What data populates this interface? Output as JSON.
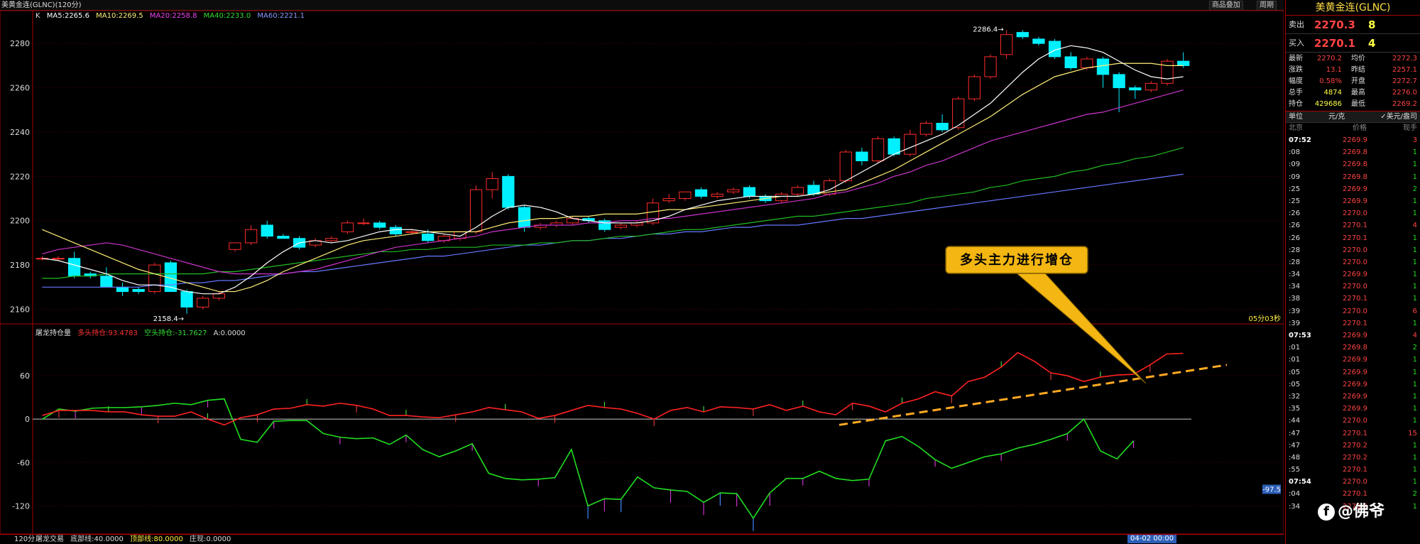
{
  "header": {
    "title": "美黄金连(GLNC)(120分)",
    "buttons": [
      "商品叠加",
      "周期"
    ]
  },
  "ma_legend": {
    "k": "K",
    "ma5": "MA5:2265.6",
    "ma10": "MA10:2269.5",
    "ma20": "MA20:2258.8",
    "ma40": "MA40:2233.0",
    "ma60": "MA60:2221.1"
  },
  "sub_legend": {
    "name": "屠龙持仓量",
    "long": "多头持仓:93.4783",
    "short": "空头持仓:-31.7627",
    "a": "A:0.0000"
  },
  "bottom": {
    "period": "120分",
    "indicator": "屠龙交易",
    "bottom_line": "底部线:40.0000",
    "top_line": "顶部线:80.0000",
    "zhuang": "庄现:0.0000",
    "time_badge": "04-02 00:00"
  },
  "countdown": "05分03秒",
  "callout": "多头主力进行增仓",
  "colors": {
    "up": "#ff2b2b",
    "down": "#00f0ff",
    "ma5": "#ffffff",
    "ma10": "#ffee77",
    "ma20": "#cc33cc",
    "ma40": "#22bb22",
    "ma60": "#6677ff",
    "long": "#ff2222",
    "short": "#22dd22",
    "trend": "#ffaa22",
    "callout_bg": "#f3b612"
  },
  "chart_data": [
    {
      "type": "candlestick",
      "yticks": [
        2160,
        2180,
        2200,
        2220,
        2240,
        2260,
        2280
      ],
      "ylim": [
        2156,
        2290
      ],
      "high_label": "2286.4",
      "low_label": "2158.4",
      "candles": [
        [
          2183,
          2184,
          2182,
          2183
        ],
        [
          2183,
          2184,
          2182,
          2183
        ],
        [
          2183,
          2186,
          2174,
          2175
        ],
        [
          2176,
          2177,
          2174,
          2175
        ],
        [
          2175,
          2179,
          2171,
          2170
        ],
        [
          2170,
          2172,
          2166,
          2168
        ],
        [
          2169,
          2170,
          2167,
          2168
        ],
        [
          2168,
          2181,
          2167,
          2180
        ],
        [
          2181,
          2182,
          2168,
          2168
        ],
        [
          2168,
          2169,
          2158,
          2161
        ],
        [
          2161,
          2166,
          2160,
          2165
        ],
        [
          2165,
          2168,
          2164,
          2167
        ],
        [
          2187,
          2190,
          2186,
          2190
        ],
        [
          2190,
          2198,
          2189,
          2196
        ],
        [
          2198,
          2200,
          2192,
          2193
        ],
        [
          2193,
          2194,
          2192,
          2192
        ],
        [
          2192,
          2193,
          2187,
          2188
        ],
        [
          2189,
          2192,
          2188,
          2191
        ],
        [
          2191,
          2193,
          2190,
          2192
        ],
        [
          2195,
          2200,
          2194,
          2199
        ],
        [
          2199,
          2201,
          2198,
          2199
        ],
        [
          2199,
          2200,
          2196,
          2197
        ],
        [
          2197,
          2198,
          2193,
          2194
        ],
        [
          2195,
          2196,
          2194,
          2195
        ],
        [
          2194,
          2196,
          2190,
          2191
        ],
        [
          2191,
          2194,
          2190,
          2193
        ],
        [
          2192,
          2195,
          2191,
          2195
        ],
        [
          2195,
          2216,
          2194,
          2214
        ],
        [
          2214,
          2222,
          2210,
          2219
        ],
        [
          2220,
          2221,
          2205,
          2206
        ],
        [
          2206,
          2207,
          2195,
          2197
        ],
        [
          2197,
          2199,
          2196,
          2198
        ],
        [
          2198,
          2200,
          2197,
          2199
        ],
        [
          2199,
          2202,
          2198,
          2201
        ],
        [
          2201,
          2202,
          2199,
          2200
        ],
        [
          2200,
          2201,
          2195,
          2196
        ],
        [
          2197,
          2199,
          2196,
          2198
        ],
        [
          2198,
          2200,
          2197,
          2199
        ],
        [
          2199,
          2210,
          2198,
          2208
        ],
        [
          2209,
          2212,
          2208,
          2210
        ],
        [
          2210,
          2213,
          2209,
          2213
        ],
        [
          2214,
          2215,
          2210,
          2211
        ],
        [
          2211,
          2213,
          2210,
          2212
        ],
        [
          2213,
          2215,
          2212,
          2214
        ],
        [
          2215,
          2216,
          2210,
          2211
        ],
        [
          2211,
          2212,
          2208,
          2209
        ],
        [
          2209,
          2213,
          2208,
          2212
        ],
        [
          2212,
          2216,
          2211,
          2215
        ],
        [
          2216,
          2218,
          2211,
          2212
        ],
        [
          2212,
          2219,
          2211,
          2218
        ],
        [
          2218,
          2232,
          2217,
          2231
        ],
        [
          2231,
          2233,
          2225,
          2227
        ],
        [
          2227,
          2238,
          2226,
          2237
        ],
        [
          2237,
          2238,
          2229,
          2230
        ],
        [
          2230,
          2241,
          2229,
          2239
        ],
        [
          2239,
          2245,
          2238,
          2244
        ],
        [
          2244,
          2248,
          2240,
          2241
        ],
        [
          2242,
          2256,
          2241,
          2255
        ],
        [
          2255,
          2266,
          2254,
          2265
        ],
        [
          2265,
          2275,
          2264,
          2274
        ],
        [
          2275,
          2286,
          2273,
          2284
        ],
        [
          2285,
          2286,
          2282,
          2283
        ],
        [
          2282,
          2283,
          2279,
          2280
        ],
        [
          2281,
          2282,
          2273,
          2274
        ],
        [
          2274,
          2276,
          2268,
          2269
        ],
        [
          2269,
          2274,
          2268,
          2273
        ],
        [
          2273,
          2274,
          2260,
          2266
        ],
        [
          2266,
          2267,
          2249,
          2260
        ],
        [
          2260,
          2261,
          2255,
          2259
        ],
        [
          2259,
          2263,
          2258,
          2262
        ],
        [
          2262,
          2273,
          2261,
          2272
        ],
        [
          2272,
          2276,
          2269,
          2270
        ]
      ],
      "ma5": [
        2183,
        2182,
        2180,
        2178,
        2176,
        2173,
        2171,
        2171,
        2170,
        2168,
        2167,
        2167,
        2170,
        2175,
        2181,
        2186,
        2190,
        2191,
        2190,
        2191,
        2193,
        2195,
        2196,
        2196,
        2195,
        2194,
        2193,
        2197,
        2202,
        2206,
        2207,
        2206,
        2204,
        2201,
        2200,
        2199,
        2199,
        2199,
        2200,
        2202,
        2205,
        2207,
        2209,
        2210,
        2211,
        2211,
        2211,
        2211,
        2212,
        2214,
        2218,
        2222,
        2226,
        2230,
        2233,
        2236,
        2239,
        2243,
        2248,
        2253,
        2260,
        2267,
        2273,
        2277,
        2279,
        2278,
        2276,
        2272,
        2268,
        2265,
        2264,
        2265
      ],
      "ma10": [
        2196,
        2193,
        2190,
        2187,
        2184,
        2181,
        2178,
        2176,
        2174,
        2172,
        2170,
        2168,
        2168,
        2170,
        2173,
        2177,
        2180,
        2183,
        2186,
        2189,
        2191,
        2192,
        2193,
        2194,
        2195,
        2195,
        2195,
        2195,
        2197,
        2199,
        2200,
        2201,
        2201,
        2202,
        2202,
        2203,
        2203,
        2203,
        2204,
        2205,
        2205,
        2206,
        2207,
        2208,
        2209,
        2210,
        2211,
        2211,
        2212,
        2213,
        2214,
        2217,
        2220,
        2223,
        2227,
        2231,
        2235,
        2239,
        2243,
        2247,
        2252,
        2257,
        2261,
        2265,
        2267,
        2269,
        2270,
        2271,
        2271,
        2271,
        2270,
        2270
      ],
      "ma20": [
        2185,
        2187,
        2188,
        2189,
        2190,
        2189,
        2187,
        2185,
        2183,
        2181,
        2179,
        2177,
        2176,
        2176,
        2176,
        2176,
        2177,
        2178,
        2180,
        2182,
        2184,
        2186,
        2188,
        2189,
        2190,
        2191,
        2192,
        2193,
        2195,
        2196,
        2197,
        2198,
        2198,
        2198,
        2199,
        2199,
        2200,
        2200,
        2201,
        2201,
        2202,
        2203,
        2204,
        2205,
        2206,
        2207,
        2208,
        2209,
        2210,
        2212,
        2213,
        2215,
        2217,
        2220,
        2222,
        2225,
        2227,
        2230,
        2233,
        2236,
        2238,
        2240,
        2242,
        2244,
        2246,
        2248,
        2249,
        2251,
        2253,
        2255,
        2257,
        2259
      ],
      "ma40": [
        2174,
        2174,
        2175,
        2175,
        2176,
        2176,
        2176,
        2176,
        2176,
        2176,
        2176,
        2177,
        2177,
        2178,
        2179,
        2180,
        2181,
        2182,
        2183,
        2184,
        2185,
        2186,
        2186,
        2187,
        2187,
        2188,
        2188,
        2188,
        2189,
        2189,
        2189,
        2190,
        2190,
        2191,
        2191,
        2192,
        2193,
        2193,
        2194,
        2195,
        2196,
        2196,
        2197,
        2198,
        2199,
        2200,
        2201,
        2202,
        2202,
        2203,
        2204,
        2205,
        2206,
        2207,
        2208,
        2210,
        2211,
        2212,
        2213,
        2215,
        2216,
        2218,
        2219,
        2220,
        2222,
        2223,
        2225,
        2226,
        2228,
        2229,
        2231,
        2233
      ],
      "ma60": [
        2170,
        2170,
        2170,
        2170,
        2170,
        2170,
        2170,
        2171,
        2171,
        2172,
        2172,
        2173,
        2173,
        2174,
        2175,
        2176,
        2177,
        2177,
        2178,
        2179,
        2180,
        2181,
        2182,
        2183,
        2184,
        2184,
        2185,
        2186,
        2187,
        2188,
        2189,
        2189,
        2190,
        2191,
        2191,
        2192,
        2192,
        2193,
        2194,
        2194,
        2195,
        2195,
        2196,
        2197,
        2197,
        2198,
        2198,
        2198,
        2199,
        2200,
        2201,
        2201,
        2202,
        2203,
        2204,
        2205,
        2206,
        2207,
        2208,
        2209,
        2210,
        2211,
        2212,
        2213,
        2214,
        2215,
        2216,
        2217,
        2218,
        2219,
        2220,
        2221
      ]
    },
    {
      "type": "line",
      "yticks": [
        60,
        0,
        -60,
        -120
      ],
      "ylim": [
        -155,
        118
      ],
      "long": [
        5,
        12,
        12,
        12,
        10,
        10,
        6,
        4,
        4,
        10,
        0,
        -8,
        2,
        6,
        14,
        15,
        20,
        18,
        22,
        19,
        14,
        5,
        5,
        3,
        2,
        6,
        10,
        16,
        13,
        10,
        1,
        5,
        12,
        19,
        16,
        14,
        8,
        0,
        12,
        16,
        10,
        17,
        16,
        14,
        20,
        12,
        18,
        10,
        6,
        22,
        18,
        10,
        22,
        28,
        38,
        32,
        52,
        58,
        72,
        92,
        80,
        64,
        60,
        52,
        58,
        61,
        62,
        75,
        90,
        91
      ],
      "short": [
        0,
        14,
        11,
        15,
        16,
        16,
        17,
        19,
        22,
        20,
        26,
        28,
        -28,
        -32,
        -3,
        -2,
        -2,
        -20,
        -25,
        -27,
        -26,
        -35,
        -22,
        -42,
        -52,
        -44,
        -34,
        -75,
        -82,
        -84,
        -83,
        -81,
        -42,
        -120,
        -110,
        -111,
        -80,
        -95,
        -98,
        -100,
        -115,
        -102,
        -103,
        -137,
        -102,
        -82,
        -82,
        -72,
        -82,
        -85,
        -83,
        -30,
        -24,
        -38,
        -56,
        -68,
        -60,
        -52,
        -48,
        -40,
        -35,
        -28,
        -20,
        0,
        -44,
        -55,
        -30
      ]
    }
  ],
  "panel": {
    "title": "美黄金连(GLNC)",
    "sell_label": "卖出",
    "sell_price": "2270.3",
    "sell_qty": "8",
    "buy_label": "买入",
    "buy_price": "2270.1",
    "buy_qty": "4",
    "stats": [
      [
        "最新",
        "2270.2",
        "均价",
        "2272.3"
      ],
      [
        "涨跌",
        "13.1",
        "昨结",
        "2257.1"
      ],
      [
        "幅度",
        "0.58%",
        "开盘",
        "2272.7"
      ],
      [
        "总手",
        "4874",
        "最高",
        "2276.0"
      ],
      [
        "持仓",
        "429686",
        "最低",
        "2269.2"
      ]
    ],
    "unit_label": "单位",
    "unit_value": "元/克",
    "currency": "✓美元/盎司",
    "col_headers": [
      "北京",
      "价格",
      "现手"
    ],
    "ticks": [
      [
        "07:52",
        "2269.9",
        "3"
      ],
      [
        ":08",
        "2269.8",
        "1"
      ],
      [
        ":09",
        "2269.8",
        "1"
      ],
      [
        ":09",
        "2269.8",
        "1"
      ],
      [
        ":25",
        "2269.9",
        "2"
      ],
      [
        ":25",
        "2269.9",
        "1"
      ],
      [
        ":26",
        "2270.0",
        "1"
      ],
      [
        ":26",
        "2270.1",
        "4"
      ],
      [
        ":26",
        "2270.1",
        "1"
      ],
      [
        ":28",
        "2270.0",
        "1"
      ],
      [
        ":28",
        "2270.0",
        "1"
      ],
      [
        ":34",
        "2269.9",
        "1"
      ],
      [
        ":34",
        "2270.0",
        "1"
      ],
      [
        ":38",
        "2270.1",
        "1"
      ],
      [
        ":39",
        "2270.0",
        "6"
      ],
      [
        ":39",
        "2270.1",
        "1"
      ],
      [
        "07:53",
        "2269.9",
        "4"
      ],
      [
        ":01",
        "2269.8",
        "2"
      ],
      [
        ":01",
        "2269.9",
        "1"
      ],
      [
        ":05",
        "2269.9",
        "1"
      ],
      [
        ":05",
        "2269.9",
        "1"
      ],
      [
        ":32",
        "2269.9",
        "1"
      ],
      [
        ":35",
        "2269.9",
        "1"
      ],
      [
        ":44",
        "2270.0",
        "1"
      ],
      [
        ":47",
        "2270.1",
        "15"
      ],
      [
        ":47",
        "2270.2",
        "1"
      ],
      [
        ":48",
        "2270.2",
        "1"
      ],
      [
        ":55",
        "2270.1",
        "1"
      ],
      [
        "07:54",
        "2270.0",
        "1"
      ],
      [
        ":04",
        "2270.1",
        "2"
      ],
      [
        ":34",
        "2270.2",
        "1"
      ]
    ],
    "watermark": "@佛爷"
  }
}
